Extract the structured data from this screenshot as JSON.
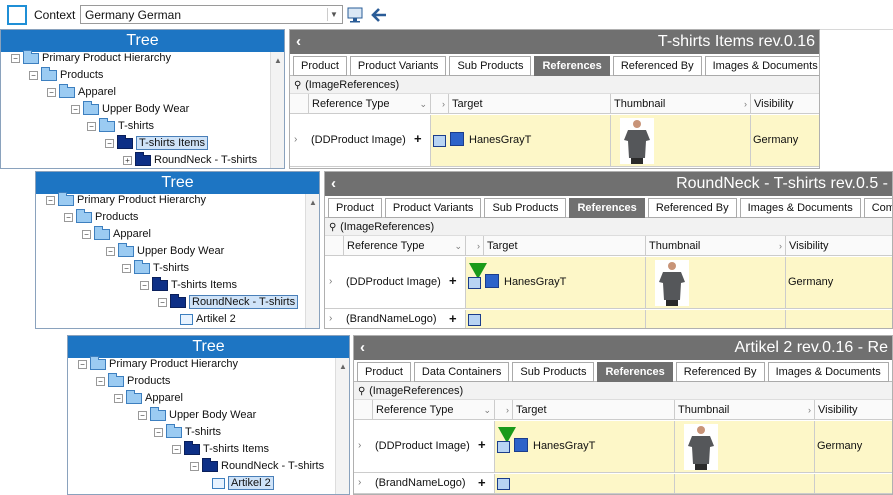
{
  "context": {
    "label": "Context",
    "value": "Germany German"
  },
  "panels": [
    {
      "tree_title": "Tree",
      "tree_nodes": [
        "Primary Product Hierarchy",
        "Products",
        "Apparel",
        "Upper Body Wear",
        "T-shirts",
        "T-shirts Items",
        "RoundNeck - T-shirts"
      ],
      "selected": "T-shirts Items",
      "detail_title": "T-shirts Items rev.0.16",
      "tabs": [
        "Product",
        "Product Variants",
        "Sub Products",
        "References",
        "Referenced By",
        "Images & Documents"
      ],
      "active_tab": "References",
      "group": "(ImageReferences)",
      "columns": [
        "Reference Type",
        "Target",
        "Thumbnail",
        "Visibility"
      ],
      "rows": [
        {
          "type": "(DDProduct Image)",
          "target": "HanesGrayT",
          "visibility": "Germany"
        }
      ]
    },
    {
      "tree_title": "Tree",
      "tree_nodes": [
        "Primary Product Hierarchy",
        "Products",
        "Apparel",
        "Upper Body Wear",
        "T-shirts",
        "T-shirts Items",
        "RoundNeck - T-shirts",
        "Artikel 2"
      ],
      "selected": "RoundNeck - T-shirts",
      "detail_title": "RoundNeck - T-shirts rev.0.5 -",
      "tabs": [
        "Product",
        "Product Variants",
        "Sub Products",
        "References",
        "Referenced By",
        "Images & Documents",
        "Com"
      ],
      "active_tab": "References",
      "group": "(ImageReferences)",
      "columns": [
        "Reference Type",
        "Target",
        "Thumbnail",
        "Visibility"
      ],
      "rows": [
        {
          "type": "(DDProduct Image)",
          "target": "HanesGrayT",
          "visibility": "Germany"
        },
        {
          "type": "(BrandNameLogo)",
          "target": "",
          "visibility": ""
        }
      ]
    },
    {
      "tree_title": "Tree",
      "tree_nodes": [
        "Primary Product Hierarchy",
        "Products",
        "Apparel",
        "Upper Body Wear",
        "T-shirts",
        "T-shirts Items",
        "RoundNeck - T-shirts",
        "Artikel 2"
      ],
      "selected": "Artikel 2",
      "detail_title": "Artikel 2 rev.0.16 - Re",
      "tabs": [
        "Product",
        "Data Containers",
        "Sub Products",
        "References",
        "Referenced By",
        "Images & Documents"
      ],
      "active_tab": "References",
      "group": "(ImageReferences)",
      "columns": [
        "Reference Type",
        "Target",
        "Thumbnail",
        "Visibility"
      ],
      "rows": [
        {
          "type": "(DDProduct Image)",
          "target": "HanesGrayT",
          "visibility": "Germany"
        },
        {
          "type": "(BrandNameLogo)",
          "target": "",
          "visibility": ""
        }
      ]
    }
  ],
  "colors": {
    "tree_header": "#1d75c3",
    "detail_header": "#707070",
    "highlight": "#fdf7c8",
    "inherited_marker": "#1a9a1a"
  },
  "icons": [
    "app-logo-icon",
    "monitor-icon",
    "back-arrow-icon",
    "folder-icon",
    "article-icon",
    "expand-icon",
    "pin-icon",
    "reference-icon",
    "target-icon",
    "inherited-marker-icon"
  ]
}
